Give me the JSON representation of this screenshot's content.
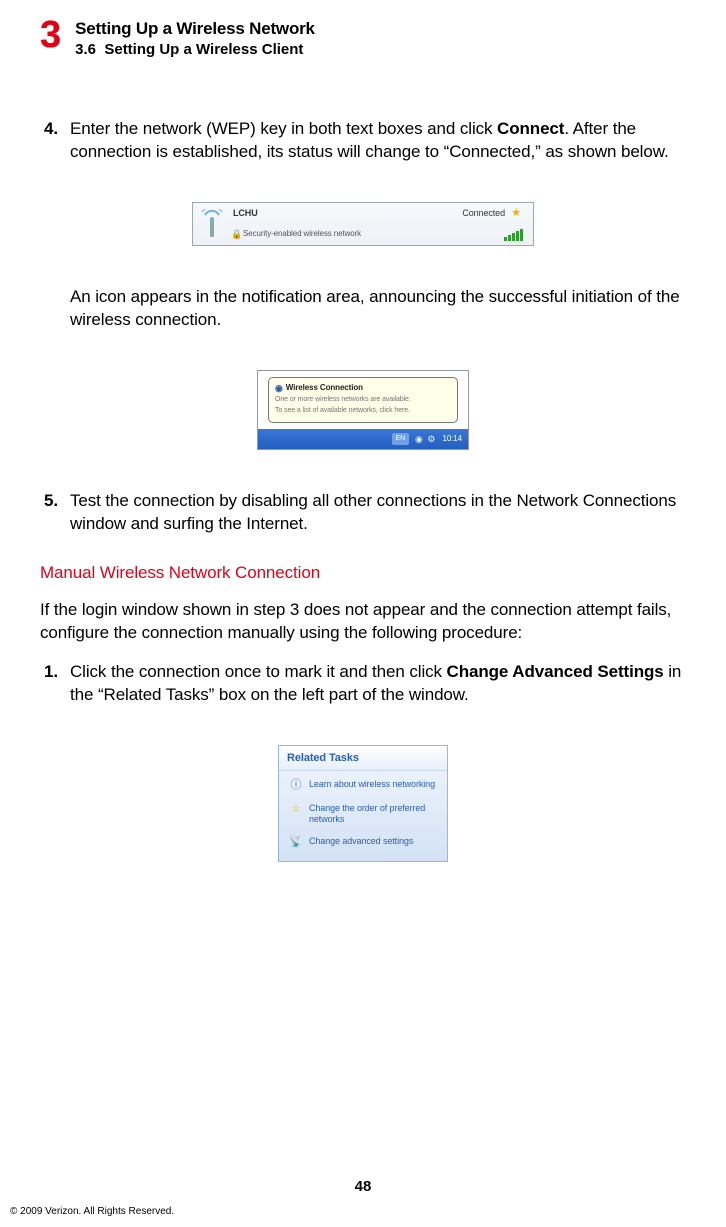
{
  "header": {
    "chapter_num": "3",
    "chapter_title": "Setting Up a Wireless Network",
    "section_num": "3.6",
    "section_title": "Setting Up a Wireless Client"
  },
  "step4": {
    "num": "4.",
    "text_a": "Enter the network (WEP) key in both text boxes and click ",
    "bold_a": "Connect",
    "text_b": ". After the connection is established, its status will change to “Connected,” as shown below."
  },
  "fig1": {
    "ssid": "LCHU",
    "security": "Security-enabled wireless network",
    "status": "Connected"
  },
  "follow4": "An icon appears in the notification area, announcing the successful initiation of the wireless connection.",
  "fig2": {
    "title": "Wireless Connection",
    "line1": "One or more wireless networks are available.",
    "line2": "To see a list of available networks, click here.",
    "lang": "EN",
    "time": "10:14"
  },
  "step5": {
    "num": "5.",
    "text": "Test the connection by disabling all other connections in the Network Connections window and surfing the Internet."
  },
  "manual": {
    "heading": "Manual Wireless Network Connection",
    "intro": "If the login window shown in step 3 does not appear and the connection attempt fails, configure the connection manually using the following procedure:"
  },
  "mstep1": {
    "num": "1.",
    "text_a": "Click the connection once to mark it and then click ",
    "bold_a": "Change Advanced Settings",
    "text_b": " in the “Related Tasks” box on the left part of the window."
  },
  "fig3": {
    "header": "Related Tasks",
    "items": [
      "Learn about wireless networking",
      "Change the order of preferred networks",
      "Change advanced settings"
    ]
  },
  "page_num": "48",
  "copyright": "© 2009 Verizon. All Rights Reserved."
}
